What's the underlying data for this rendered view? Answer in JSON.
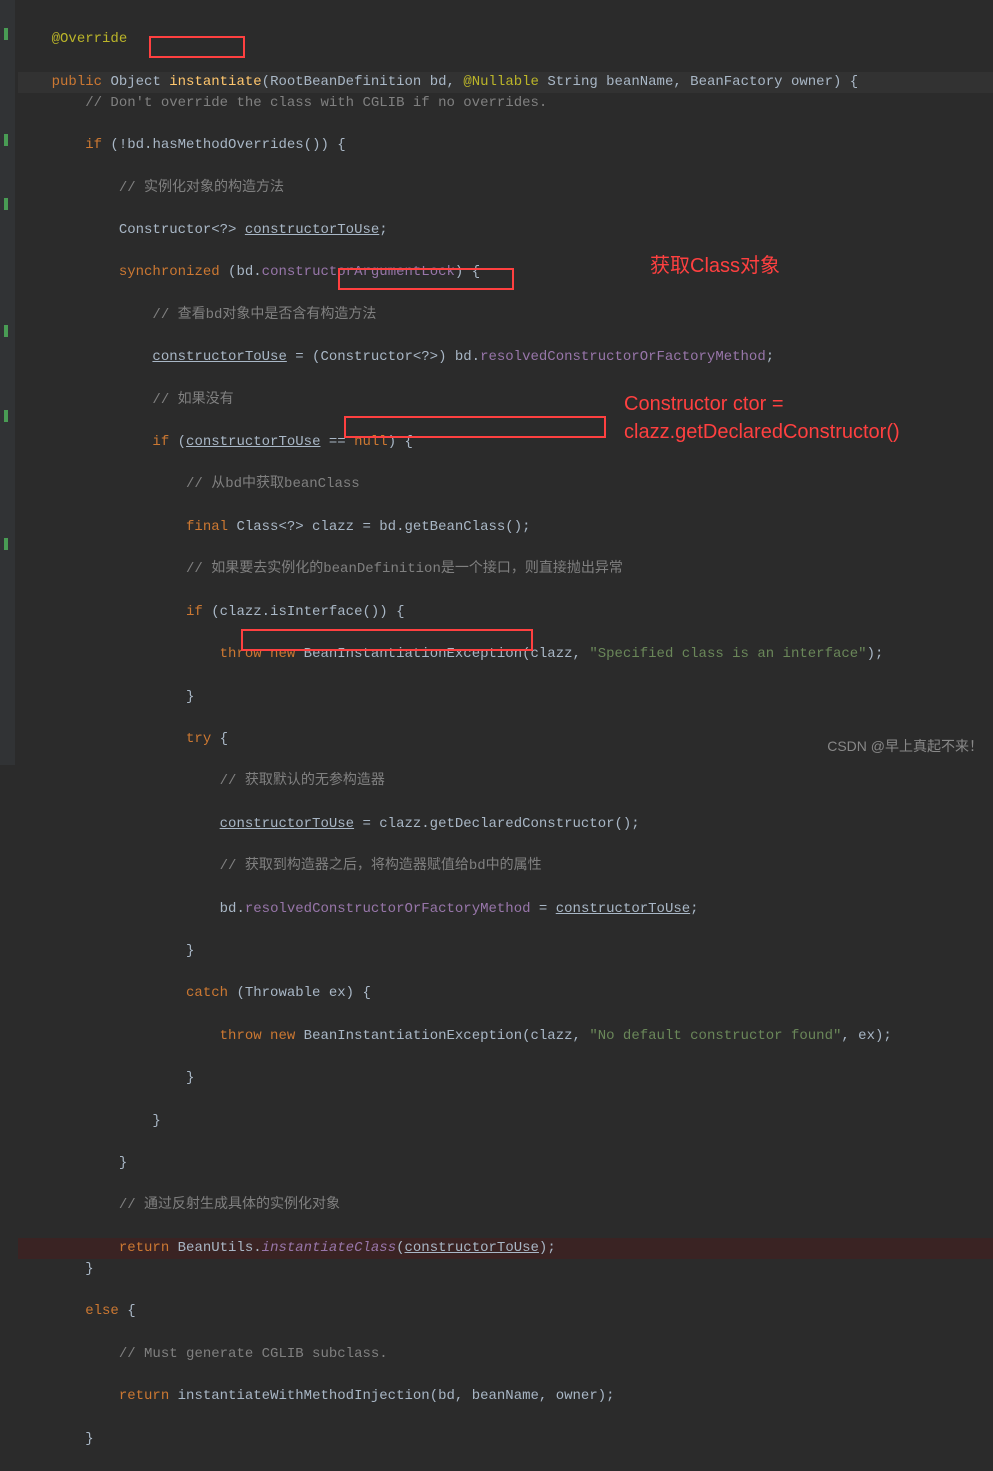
{
  "code": {
    "l1": "@Override",
    "l2_pub": "public",
    "l2_obj": "Object ",
    "l2_method": "instantiate",
    "l2_args1": "(RootBeanDefinition bd, ",
    "l2_null": "@Nullable",
    "l2_args2": " String beanName, BeanFactory owner) {",
    "l3": "// Don't override the class with CGLIB if no overrides.",
    "l4_if": "if",
    "l4_cond": " (!bd.hasMethodOverrides()) {",
    "l5": "// 实例化对象的构造方法",
    "l6_type": "Constructor<?> ",
    "l6_var": "constructorToUse",
    "l6_semi": ";",
    "l7_sync": "synchronized",
    "l7_open": " (bd.",
    "l7_field": "constructorArgumentLock",
    "l7_close": ") {",
    "l8": "// 查看bd对象中是否含有构造方法",
    "l9_var": "constructorToUse",
    "l9_eq": " = (Constructor<?>) bd.",
    "l9_field": "resolvedConstructorOrFactoryMethod",
    "l9_semi": ";",
    "l10": "// 如果没有",
    "l11_if": "if",
    "l11_open": " (",
    "l11_var": "constructorToUse",
    "l11_eq": " == ",
    "l11_null": "null",
    "l11_close": ") {",
    "l12": "// 从bd中获取beanClass",
    "l13_final": "final",
    "l13_type": " Class<?> clazz = bd.getBeanClass();",
    "l14": "// 如果要去实例化的beanDefinition是一个接口，则直接抛出异常",
    "l15_if": "if",
    "l15_cond": " (clazz.isInterface()) {",
    "l16_throw": "throw new",
    "l16_rest": " BeanInstantiationException(clazz, ",
    "l16_str": "\"Specified class is an interface\"",
    "l16_close": ");",
    "l17": "}",
    "l18_try": "try",
    "l18_brace": " {",
    "l19": "// 获取默认的无参构造器",
    "l20_var": "constructorToUse",
    "l20_rest": " = clazz.getDeclaredConstructor();",
    "l21": "// 获取到构造器之后，将构造器赋值给bd中的属性",
    "l22_pre": "bd.",
    "l22_field": "resolvedConstructorOrFactoryMethod",
    "l22_eq": " = ",
    "l22_var": "constructorToUse",
    "l22_semi": ";",
    "l23": "}",
    "l24_catch": "catch",
    "l24_rest": " (Throwable ex) {",
    "l25_throw": "throw new",
    "l25_rest": " BeanInstantiationException(clazz, ",
    "l25_str": "\"No default constructor found\"",
    "l25_close": ", ex);",
    "l26": "}",
    "l27": "}",
    "l28": "}",
    "l29": "// 通过反射生成具体的实例化对象",
    "l30_ret": "return",
    "l30_rest": " BeanUtils.",
    "l30_method": "instantiateClass",
    "l30_open": "(",
    "l30_var": "constructorToUse",
    "l30_close": ");",
    "l31": "}",
    "l32_else": "else",
    "l32_brace": " {",
    "l33": "// Must generate CGLIB subclass.",
    "l34_ret": "return",
    "l34_rest": " instantiateWithMethodInjection(bd, beanName, owner);",
    "l35": "}"
  },
  "annotations": {
    "a1": "获取Class对象",
    "a2": "Constructor ctor = clazz.getDeclaredConstructor()"
  },
  "watermark": "CSDN @早上真起不来！"
}
